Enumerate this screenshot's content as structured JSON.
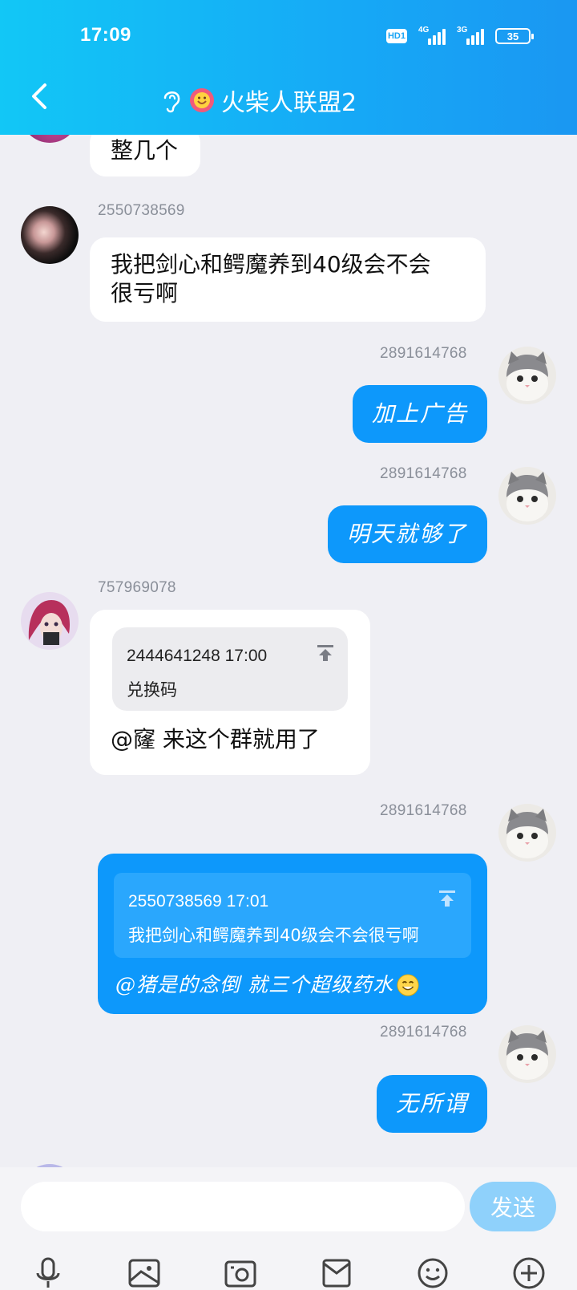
{
  "status_bar": {
    "time": "17:09",
    "hd": "HD1",
    "net1": "4G",
    "net2": "3G",
    "battery": "35"
  },
  "header": {
    "title": "火柴人联盟2"
  },
  "messages": [
    {
      "text": "整几个"
    },
    {
      "sender": "2550738569",
      "text_line1": "我把剑心和鳄魔养到40级会不会",
      "text_line2": "很亏啊"
    },
    {
      "sender": "2891614768",
      "text": "加上广告"
    },
    {
      "sender": "2891614768",
      "text": "明天就够了"
    },
    {
      "sender": "757969078",
      "quote_meta": "2444641248 17:00",
      "quote_text": "兑换码",
      "text": "@窿 来这个群就用了"
    },
    {
      "sender": "2891614768",
      "quote_meta": "2550738569 17:01",
      "quote_text": "我把剑心和鳄魔养到40级会不会很亏啊",
      "text": "@猪是的念倒 就三个超级药水"
    },
    {
      "sender": "2891614768",
      "text": "无所谓"
    }
  ],
  "input": {
    "placeholder": "",
    "send_label": "发送"
  },
  "toolbar": [
    "microphone-icon",
    "image-icon",
    "camera-icon",
    "file-icon",
    "emoji-icon",
    "plus-icon"
  ],
  "colors": {
    "header": "#16a9f6",
    "outgoing": "#0d98fb",
    "incoming": "#ffffff",
    "background": "#efeff4",
    "send_disabled": "#8fd1fb"
  }
}
